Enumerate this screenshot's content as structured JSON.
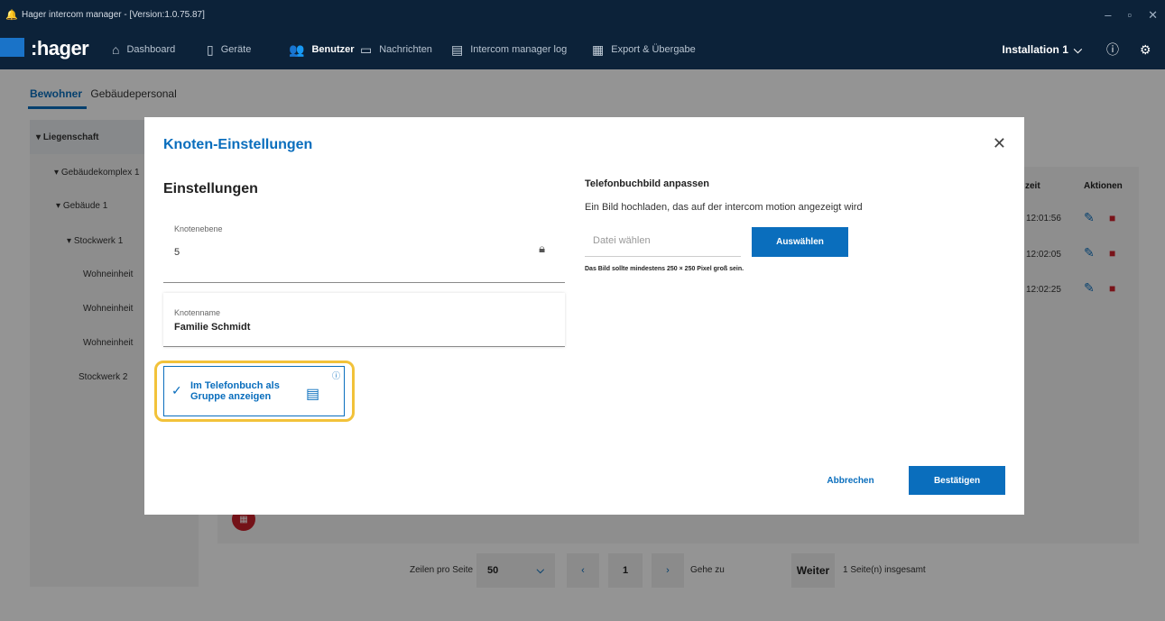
{
  "window": {
    "title": "Hager intercom manager - [Version:1.0.75.87]",
    "controls": [
      "–",
      "▫",
      "✕"
    ]
  },
  "nav": {
    "brand": ":hager",
    "items": [
      {
        "label": "Dashboard",
        "icon": "home-icon"
      },
      {
        "label": "Geräte",
        "icon": "device-icon"
      },
      {
        "label": "Benutzer",
        "icon": "users-icon",
        "active": true
      },
      {
        "label": "Nachrichten",
        "icon": "message-icon"
      },
      {
        "label": "Intercom manager log",
        "icon": "log-icon"
      },
      {
        "label": "Export & Übergabe",
        "icon": "export-icon"
      }
    ],
    "installation": "Installation 1"
  },
  "page": {
    "tabs": [
      "Bewohner",
      "Gebäudepersonal"
    ],
    "tree": [
      "Liegenschaft",
      "Gebäudekomplex 1",
      "Gebäude 1",
      "Stockwerk 1",
      "Wohneinheit",
      "Wohneinheit",
      "Wohneinheit",
      "Stockwerk 2"
    ],
    "table_headers": [
      "zeit",
      "Aktionen"
    ],
    "times": [
      "12:01:56",
      "12:02:05",
      "12:02:25"
    ]
  },
  "pager": {
    "rows_label": "Zeilen pro Seite",
    "rows_value": "50",
    "page": "1",
    "goto_label": "Gehe zu",
    "next": "Weiter",
    "total": "1 Seite(n) insgesamt"
  },
  "modal": {
    "title": "Knoten-Einstellungen",
    "section": "Einstellungen",
    "level_label": "Knotenebene",
    "level_value": "5",
    "name_label": "Knotenname",
    "name_value": "Familie Schmidt",
    "group_toggle": "Im Telefonbuch als Gruppe anzeigen",
    "phone_title": "Telefonbuchbild anpassen",
    "phone_desc": "Ein Bild hochladen, das auf der intercom motion angezeigt wird",
    "file_placeholder": "Datei wählen",
    "select": "Auswählen",
    "hint": "Das Bild sollte mindestens 250 × 250 Pixel groß sein.",
    "cancel": "Abbrechen",
    "confirm": "Bestätigen"
  },
  "colors": {
    "accent": "#0a6ebd",
    "navbar": "#0c2239",
    "highlight": "#f2c23a",
    "delete": "#d0222c"
  }
}
